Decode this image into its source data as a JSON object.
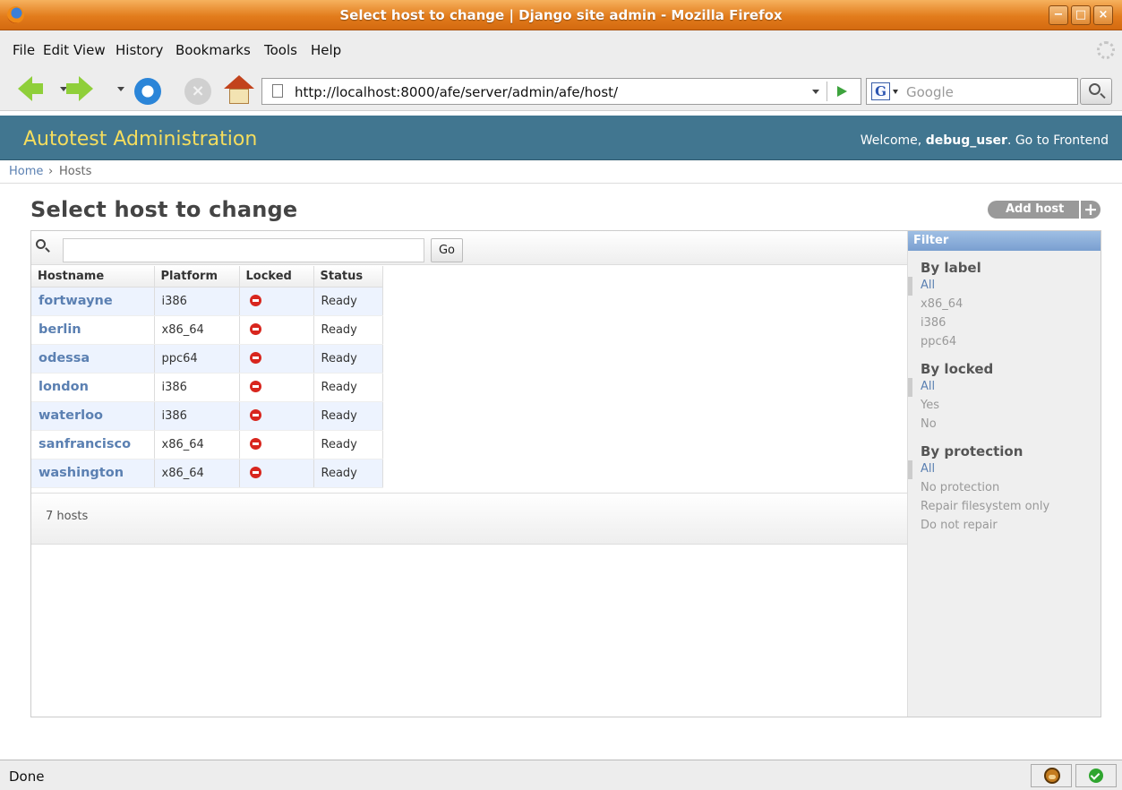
{
  "window": {
    "title": "Select host to change | Django site admin - Mozilla Firefox",
    "minimize": "−",
    "maximize": "□",
    "close": "×"
  },
  "menu": [
    "File",
    "Edit",
    "View",
    "History",
    "Bookmarks",
    "Tools",
    "Help"
  ],
  "browser": {
    "url": "http://localhost:8000/afe/server/admin/afe/host/",
    "search_engine": "G",
    "search_placeholder": "Google",
    "status": "Done"
  },
  "admin": {
    "brand": "Autotest Administration",
    "welcome": "Welcome, ",
    "username": "debug_user",
    "goto_frontend": ". Go to Frontend",
    "breadcrumb_home": "Home",
    "breadcrumb_sep": "›",
    "breadcrumb_current": "Hosts",
    "page_title": "Select host to change",
    "add_button": "Add host",
    "add_plus": "+",
    "search_value": "",
    "go_button": "Go",
    "result_count": "7 hosts"
  },
  "table": {
    "columns": [
      "Hostname",
      "Platform",
      "Locked",
      "Status"
    ],
    "rows": [
      {
        "hostname": "fortwayne",
        "platform": "i386",
        "locked": "no-icon",
        "status": "Ready"
      },
      {
        "hostname": "berlin",
        "platform": "x86_64",
        "locked": "no-icon",
        "status": "Ready"
      },
      {
        "hostname": "odessa",
        "platform": "ppc64",
        "locked": "no-icon",
        "status": "Ready"
      },
      {
        "hostname": "london",
        "platform": "i386",
        "locked": "no-icon",
        "status": "Ready"
      },
      {
        "hostname": "waterloo",
        "platform": "i386",
        "locked": "no-icon",
        "status": "Ready"
      },
      {
        "hostname": "sanfrancisco",
        "platform": "x86_64",
        "locked": "no-icon",
        "status": "Ready"
      },
      {
        "hostname": "washington",
        "platform": "x86_64",
        "locked": "no-icon",
        "status": "Ready"
      }
    ]
  },
  "filter": {
    "title": "Filter",
    "groups": [
      {
        "heading": "By label",
        "options": [
          "All",
          "x86_64",
          "i386",
          "ppc64"
        ]
      },
      {
        "heading": "By locked",
        "options": [
          "All",
          "Yes",
          "No"
        ]
      },
      {
        "heading": "By protection",
        "options": [
          "All",
          "No protection",
          "Repair filesystem only",
          "Do not repair"
        ]
      }
    ]
  },
  "colors": {
    "header_bg": "#417690",
    "brand_text": "#f5dd5d",
    "link": "#5b80b2",
    "row_alt": "#edf3fe"
  }
}
